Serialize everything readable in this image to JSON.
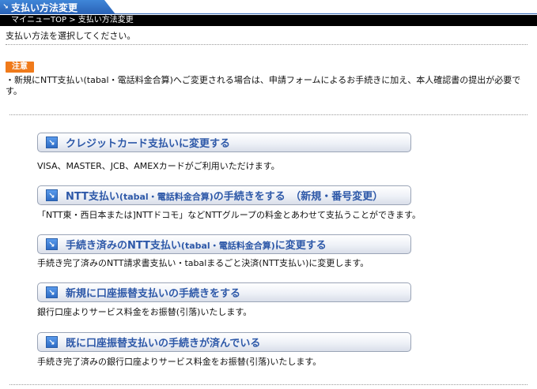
{
  "header": {
    "title": "支払い方法変更",
    "breadcrumb": "マイニューTOP > 支払い方法変更"
  },
  "intro": "支払い方法を選択してください。",
  "notice": {
    "badge": "注意",
    "text": "・新規にNTT支払い(tabal・電話料金合算)へご変更される場合は、申請フォームによるお手続きに加え、本人確認書の提出が必要です。"
  },
  "options": [
    {
      "label_main": "クレジットカード支払いに変更する",
      "label_sub": "",
      "label_tail": "",
      "desc": "VISA、MASTER、JCB、AMEXカードがご利用いただけます。"
    },
    {
      "label_main": "NTT支払い",
      "label_sub": "(tabal・電話料金合算)",
      "label_tail": "の手続きをする　（新規・番号変更）",
      "desc": "「NTT東・西日本または]NTTドコモ」などNTTグループの料金とあわせて支払うことができます。"
    },
    {
      "label_main": "手続き済みのNTT支払い",
      "label_sub": "(tabal・電話料金合算)",
      "label_tail": "に変更する",
      "desc": "手続き完了済みのNTT請求書支払い・tabalまるごと決済(NTT支払い)に変更します。"
    },
    {
      "label_main": "新規に口座振替支払いの手続きをする",
      "label_sub": "",
      "label_tail": "",
      "desc": "銀行口座よりサービス料金をお振替(引落)いたします。"
    },
    {
      "label_main": "既に口座振替支払いの手続きが済んでいる",
      "label_sub": "",
      "label_tail": "",
      "desc": "手続き完了済みの銀行口座よりサービス料金をお振替(引落)いたします。"
    }
  ],
  "colors": {
    "header_blue": "#2a62b6",
    "link_blue": "#2d58a8",
    "notice_orange": "#f07a1a"
  }
}
